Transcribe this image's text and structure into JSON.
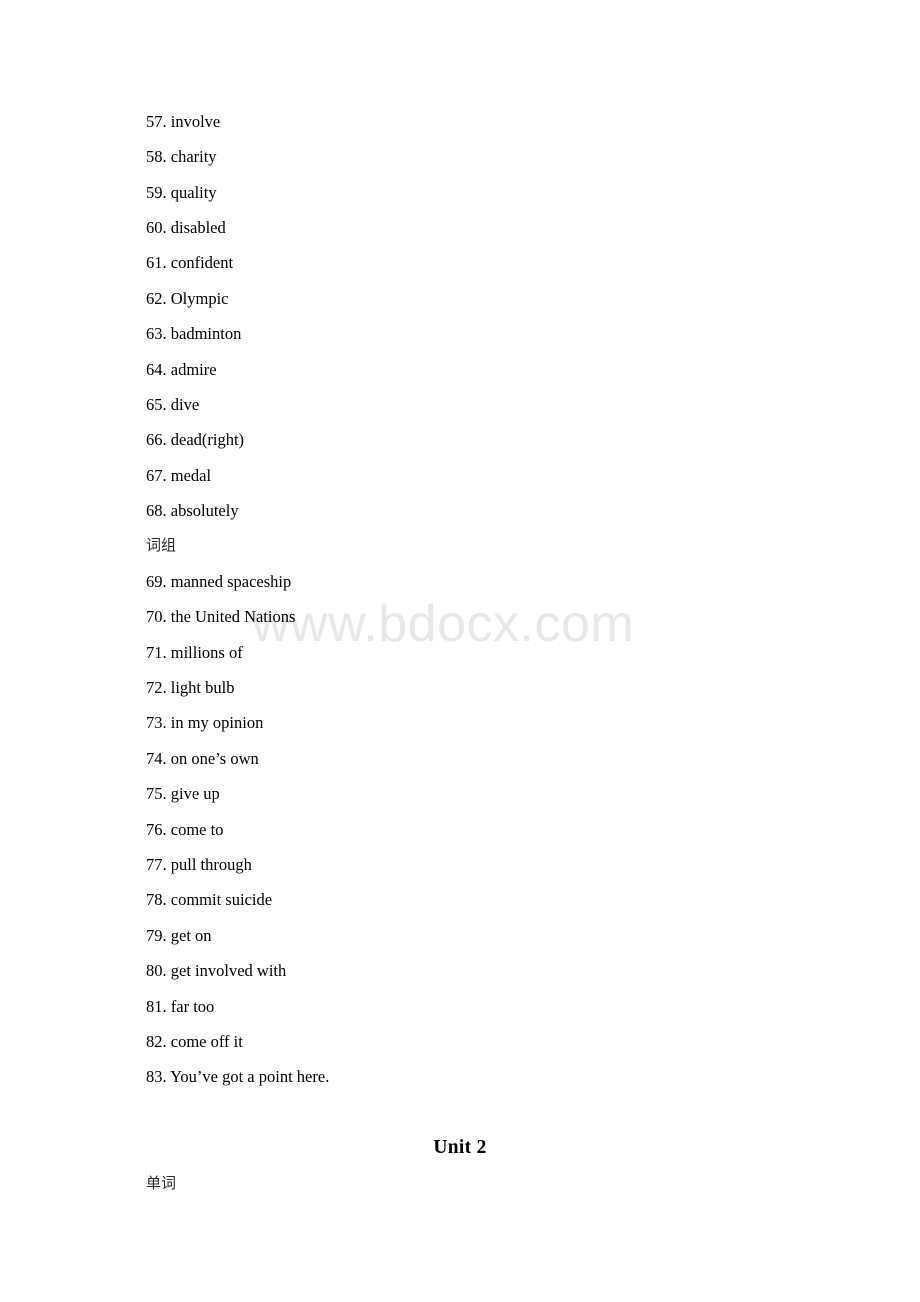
{
  "page": {
    "background_color": "#ffffff",
    "text_color": "#000000"
  },
  "watermark": {
    "text": "www.bdocx.com",
    "color": "#e8e8e8"
  },
  "sections": [
    {
      "id": "words-continued",
      "entries": [
        {
          "number": "57.",
          "term": "involve"
        },
        {
          "number": "58.",
          "term": "charity"
        },
        {
          "number": "59.",
          "term": "quality"
        },
        {
          "number": "60.",
          "term": "disabled"
        },
        {
          "number": "61.",
          "term": "confident"
        },
        {
          "number": "62.",
          "term": "Olympic"
        },
        {
          "number": "63.",
          "term": "badminton"
        },
        {
          "number": "64.",
          "term": "admire"
        },
        {
          "number": "65.",
          "term": "dive"
        },
        {
          "number": "66.",
          "term": "dead(right)"
        },
        {
          "number": "67.",
          "term": "medal"
        },
        {
          "number": "68.",
          "term": "absolutely"
        }
      ]
    },
    {
      "id": "phrases",
      "heading": "词组",
      "entries": [
        {
          "number": "69.",
          "term": "manned spaceship"
        },
        {
          "number": "70.",
          "term": "the United Nations"
        },
        {
          "number": "71.",
          "term": "millions of"
        },
        {
          "number": "72.",
          "term": "light bulb"
        },
        {
          "number": "73.",
          "term": "in my opinion"
        },
        {
          "number": "74.",
          "term": "on one’s own"
        },
        {
          "number": "75.",
          "term": "give up"
        },
        {
          "number": "76.",
          "term": "come to"
        },
        {
          "number": "77.",
          "term": "pull through"
        },
        {
          "number": "78.",
          "term": "commit suicide"
        },
        {
          "number": "79.",
          "term": "get on"
        },
        {
          "number": "80.",
          "term": "get involved with"
        },
        {
          "number": "81.",
          "term": "far too"
        },
        {
          "number": "82.",
          "term": "come off it"
        },
        {
          "number": "83.",
          "term": "You’ve got a point here."
        }
      ]
    }
  ],
  "unit_heading": "Unit 2",
  "words_heading": "单词",
  "entry_lines": {
    "l57": "57. involve",
    "l58": "58. charity",
    "l59": "59. quality",
    "l60": "60. disabled",
    "l61": "61. confident",
    "l62": "62. Olympic",
    "l63": "63. badminton",
    "l64": "64. admire",
    "l65": "65. dive",
    "l66": "66. dead(right)",
    "l67": "67. medal",
    "l68": "68. absolutely",
    "l69": "69. manned spaceship",
    "l70": "70. the United Nations",
    "l71": "71. millions of",
    "l72": "72. light bulb",
    "l73": "73. in my opinion",
    "l74": "74. on one’s own",
    "l75": "75. give up",
    "l76": "76. come to",
    "l77": "77. pull through",
    "l78": "78. commit suicide",
    "l79": "79. get on",
    "l80": "80. get involved with",
    "l81": "81. far too",
    "l82": "82. come off it",
    "l83": "83. You’ve got a point here."
  }
}
